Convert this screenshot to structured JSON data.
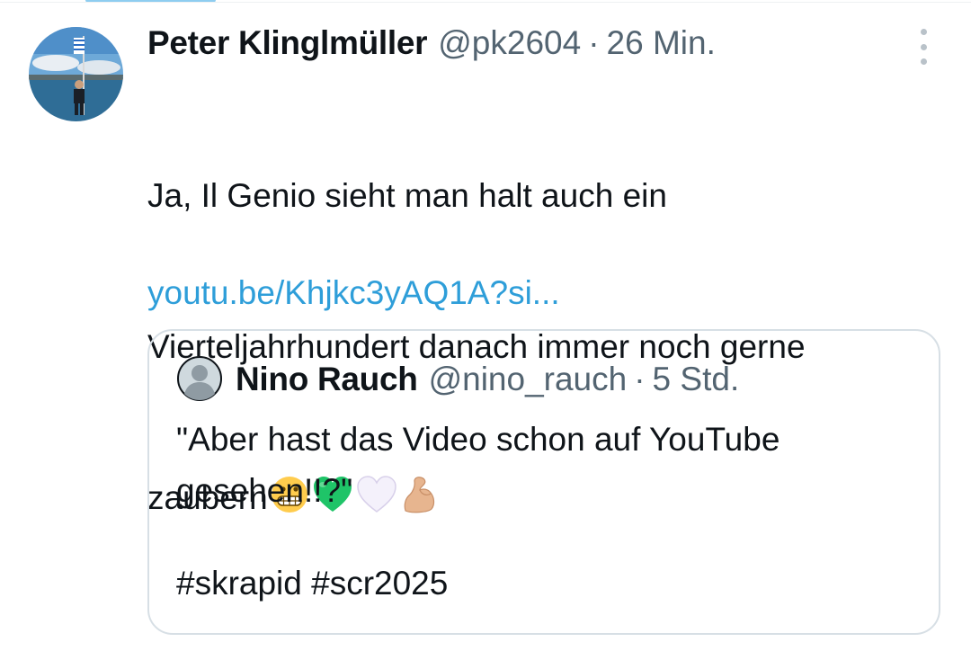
{
  "tweet": {
    "author_name": "Peter Klinglmüller",
    "handle": "@pk2604",
    "separator": "·",
    "time": "26 Min.",
    "text_lines": [
      "Ja, Il Genio sieht man halt auch ein",
      "Vierteljahrhundert danach immer noch gerne",
      "zaubern"
    ],
    "emojis": [
      "grimacing-face",
      "green-heart",
      "white-heart",
      "flexed-biceps"
    ],
    "link": "youtu.be/Khjkc3yAQ1A?si..."
  },
  "quote": {
    "author_name": "Nino Rauch",
    "handle": "@nino_rauch",
    "separator": "·",
    "time": "5 Std.",
    "text_lines": [
      "\"Aber hast das Video schon auf YouTube",
      "gesehen!!?\""
    ],
    "hashtags": "#skrapid #scr2025"
  },
  "icons": {
    "more_menu": "more-vertical-icon",
    "avatar": "avatar",
    "quote_avatar": "default-avatar"
  },
  "colors": {
    "text": "#0f1419",
    "muted": "#536471",
    "link": "#2e9ed9",
    "border": "#d7dfe5"
  }
}
